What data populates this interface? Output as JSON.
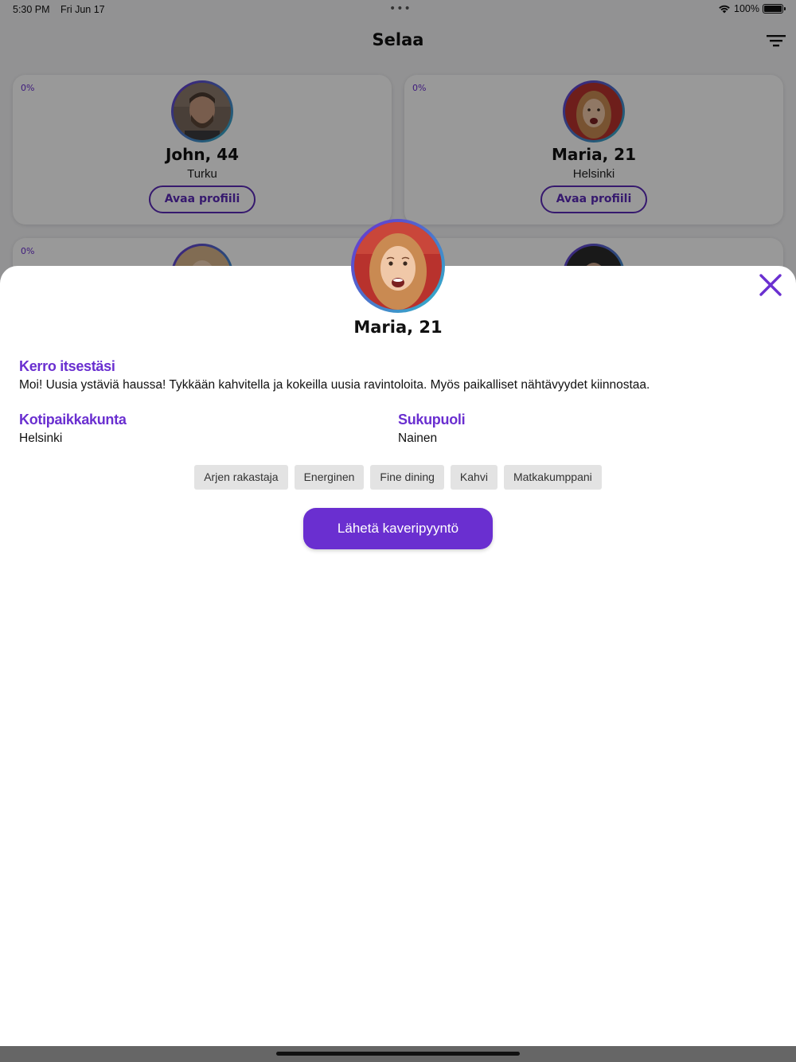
{
  "status_bar": {
    "time": "5:30 PM",
    "date": "Fri Jun 17",
    "battery": "100%"
  },
  "nav": {
    "title": "Selaa",
    "filter_icon": "filter-icon"
  },
  "cards": [
    {
      "pct": "0%",
      "name": "John, 44",
      "city": "Turku",
      "button": "Avaa profiili"
    },
    {
      "pct": "0%",
      "name": "Maria, 21",
      "city": "Helsinki",
      "button": "Avaa profiili"
    },
    {
      "pct": "0%"
    },
    {
      "pct": ""
    }
  ],
  "profile": {
    "name": "Maria, 21",
    "about_label": "Kerro itsestäsi",
    "about_text": "Moi! Uusia ystäviä haussa! Tykkään kahvitella ja kokeilla uusia ravintoloita. Myös paikalliset nähtävyydet kiinnostaa.",
    "home_label": "Kotipaikkakunta",
    "home_value": "Helsinki",
    "gender_label": "Sukupuoli",
    "gender_value": "Nainen",
    "tags": [
      "Arjen rakastaja",
      "Energinen",
      "Fine dining",
      "Kahvi",
      "Matkakumppani"
    ],
    "cta": "Lähetä kaveripyyntö"
  },
  "colors": {
    "accent": "#6a2fd0",
    "overlay": "rgba(0,0,0,0.40)"
  }
}
